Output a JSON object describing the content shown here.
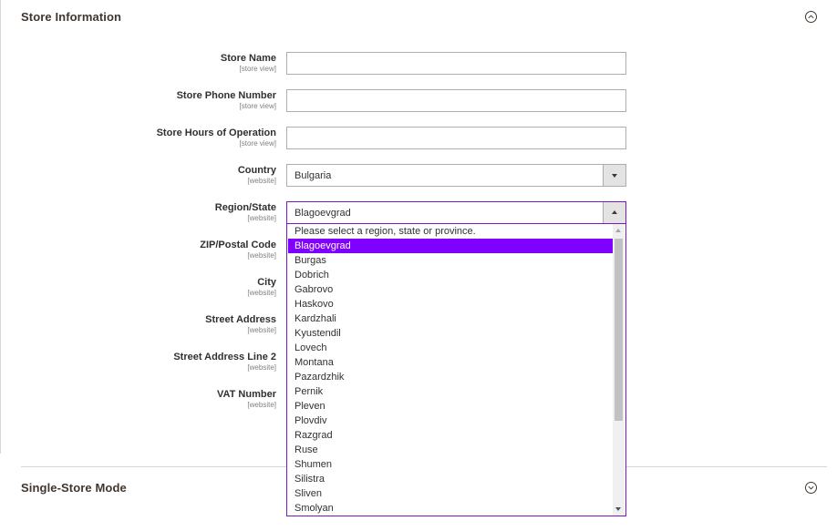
{
  "store_information": {
    "title": "Store Information",
    "toggle_icon": "collapse-up-icon",
    "fields": [
      {
        "label": "Store Name",
        "scope": "[store view]",
        "value": ""
      },
      {
        "label": "Store Phone Number",
        "scope": "[store view]",
        "value": ""
      },
      {
        "label": "Store Hours of Operation",
        "scope": "[store view]",
        "value": ""
      },
      {
        "label": "Country",
        "scope": "[website]",
        "value": "Bulgaria"
      },
      {
        "label": "Region/State",
        "scope": "[website]",
        "value": "Blagoevgrad"
      },
      {
        "label": "ZIP/Postal Code",
        "scope": "[website]"
      },
      {
        "label": "City",
        "scope": "[website]"
      },
      {
        "label": "Street Address",
        "scope": "[website]"
      },
      {
        "label": "Street Address Line 2",
        "scope": "[website]"
      },
      {
        "label": "VAT Number",
        "scope": "[website]"
      }
    ]
  },
  "region_dropdown": {
    "options": [
      "Please select a region, state or province.",
      "Blagoevgrad",
      "Burgas",
      "Dobrich",
      "Gabrovo",
      "Haskovo",
      "Kardzhali",
      "Kyustendil",
      "Lovech",
      "Montana",
      "Pazardzhik",
      "Pernik",
      "Pleven",
      "Plovdiv",
      "Razgrad",
      "Ruse",
      "Shumen",
      "Silistra",
      "Sliven",
      "Smolyan"
    ],
    "selected": "Blagoevgrad",
    "highlight_color": "#8000ff",
    "focus_border_color": "#7b16c7"
  },
  "single_store_mode": {
    "title": "Single-Store Mode",
    "toggle_icon": "expand-down-icon"
  }
}
